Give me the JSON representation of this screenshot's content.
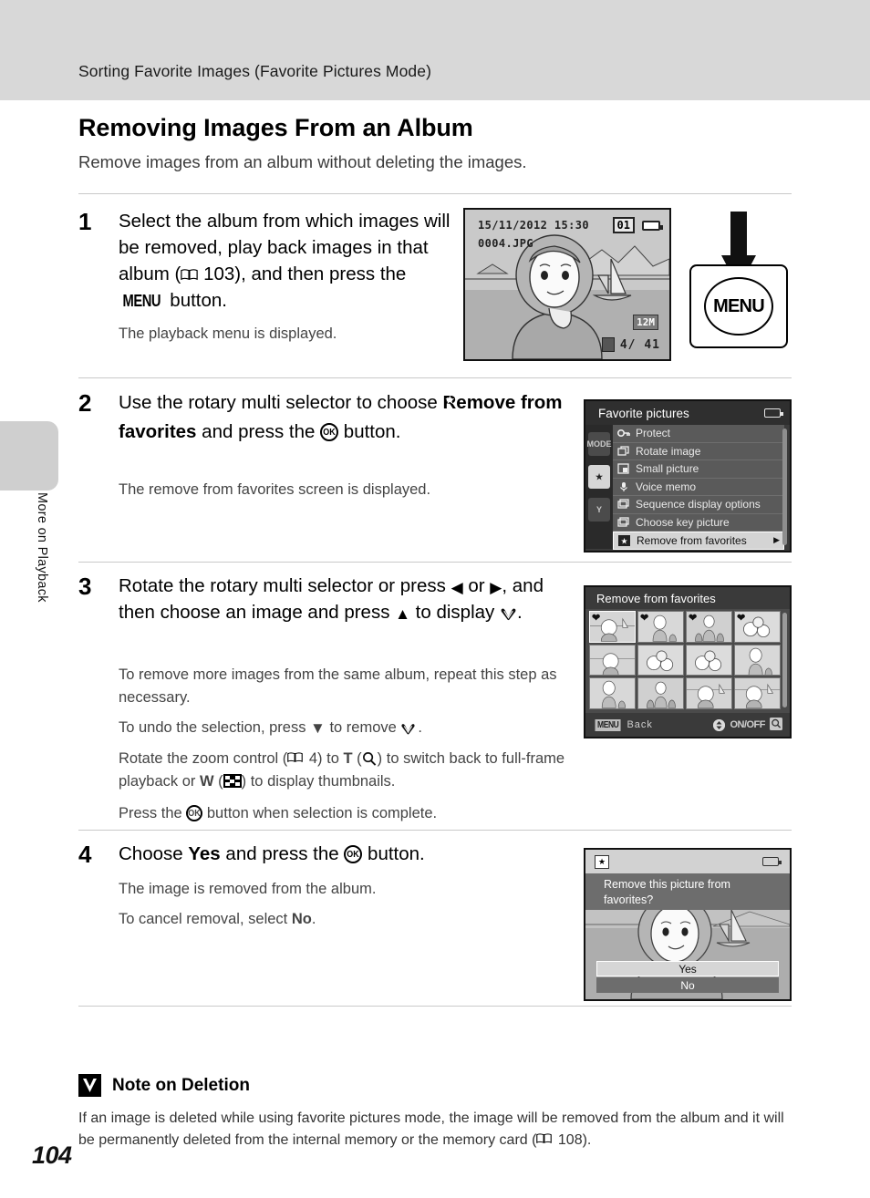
{
  "header": {
    "section_title": "Sorting Favorite Images (Favorite Pictures Mode)"
  },
  "side": {
    "chapter_label": "More on Playback",
    "page_number": "104"
  },
  "page": {
    "title": "Removing Images From an Album",
    "subtitle": "Remove images from an album without deleting the images."
  },
  "steps": [
    {
      "number": "1",
      "main_part1": "Select the album from which images will be removed, play back images in that album (",
      "ref_page": "103",
      "main_part2": "), and then press the ",
      "menu_word": "MENU",
      "main_part3": " button.",
      "sub1": "The playback menu is displayed."
    },
    {
      "number": "2",
      "main_part1": "Use the rotary multi selector to choose ",
      "bold_item": "Remove from favorites",
      "main_part2": " and press the ",
      "main_part3": " button.",
      "sub1": "The remove from favorites screen is displayed."
    },
    {
      "number": "3",
      "main_part1": "Rotate the rotary multi selector or press ",
      "arrow_left": "◀",
      "main_part2": " or ",
      "arrow_right": "▶",
      "main_part3": ", and then choose an image and press ",
      "arrow_up": "▲",
      "main_part4": " to display ",
      "main_part5": ".",
      "sub1": "To remove more images from the same album, repeat this step as necessary.",
      "sub2_a": "To undo the selection, press ",
      "sub2_arrow": "▼",
      "sub2_b": " to remove ",
      "sub2_c": ".",
      "sub3_a": "Rotate the zoom control (",
      "sub3_ref": "4",
      "sub3_b": ") to ",
      "sub3_t": "T",
      "sub3_c": " (",
      "sub3_d": ") to switch back to full-frame playback or ",
      "sub3_w": "W",
      "sub3_e": " (",
      "sub3_f": ") to display thumbnails.",
      "sub4_a": "Press the ",
      "sub4_b": " button when selection is complete."
    },
    {
      "number": "4",
      "main_part1": "Choose ",
      "bold_yes": "Yes",
      "main_part2": " and press the ",
      "main_part3": " button.",
      "sub1": "The image is removed from the album.",
      "sub2_a": "To cancel removal, select ",
      "sub2_bold": "No",
      "sub2_b": "."
    }
  ],
  "screen_playback": {
    "date": "15/11/2012 15:30",
    "filename": "0004.JPG",
    "album_number": "01",
    "image_size": "12M",
    "frame_counter": "4/   41"
  },
  "menu_button_art": {
    "label": "MENU"
  },
  "screen_menu": {
    "title": "Favorite pictures",
    "tabs": [
      {
        "name": "mode-tab",
        "label": "MODE",
        "selected": false
      },
      {
        "name": "favorites-tab",
        "label": "★",
        "selected": true
      },
      {
        "name": "setup-tab",
        "label": "Y",
        "selected": false
      }
    ],
    "items": [
      {
        "icon": "key-icon",
        "glyph": "⚿",
        "label": "Protect",
        "selected": false
      },
      {
        "icon": "rotate-icon",
        "glyph": "↻",
        "label": "Rotate image",
        "selected": false
      },
      {
        "icon": "small-picture-icon",
        "glyph": "▣",
        "label": "Small picture",
        "selected": false
      },
      {
        "icon": "microphone-icon",
        "glyph": "🎙",
        "label": "Voice memo",
        "selected": false
      },
      {
        "icon": "sequence-icon",
        "glyph": "❑",
        "label": "Sequence display options",
        "selected": false
      },
      {
        "icon": "key-picture-icon",
        "glyph": "❑",
        "label": "Choose key picture",
        "selected": false
      },
      {
        "icon": "star-icon",
        "glyph": "★",
        "label": "Remove from favorites",
        "selected": true
      }
    ],
    "selected_arrow": "▶"
  },
  "screen_thumbnails": {
    "title": "Remove from favorites",
    "thumbnails": [
      {
        "checked": true,
        "art": "portrait-boat"
      },
      {
        "checked": true,
        "art": "woman-child"
      },
      {
        "checked": true,
        "art": "family"
      },
      {
        "checked": true,
        "art": "flowers"
      },
      {
        "checked": false,
        "art": "portrait-boat"
      },
      {
        "checked": false,
        "art": "flowers"
      },
      {
        "checked": false,
        "art": "flowers"
      },
      {
        "checked": false,
        "art": "woman-child"
      },
      {
        "checked": false,
        "art": "woman-child"
      },
      {
        "checked": false,
        "art": "family"
      },
      {
        "checked": false,
        "art": "portrait-boat"
      },
      {
        "checked": false,
        "art": "portrait-boat"
      }
    ],
    "menu_tag": "MENU",
    "back_label": "Back",
    "onoff_label": "ON/OFF"
  },
  "screen_dialog": {
    "message": "Remove this picture from favorites?",
    "yes_label": "Yes",
    "no_label": "No"
  },
  "note": {
    "title": "Note on Deletion",
    "body_a": "If an image is deleted while using favorite pictures mode, the image will be removed from the album and it will be permanently deleted from the internal memory or the memory card (",
    "body_ref": "108",
    "body_b": ")."
  }
}
